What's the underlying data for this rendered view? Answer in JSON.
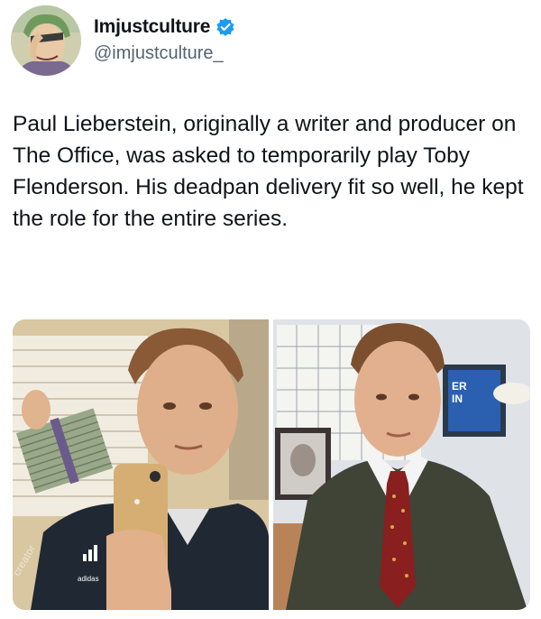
{
  "author": {
    "display_name": "Imjustculture",
    "handle": "@imjustculture_",
    "verified": true,
    "avatar_icon": "anime-avatar",
    "verified_icon": "verified-badge-icon",
    "verified_color": "#1d9bf0"
  },
  "tweet": {
    "text": "Paul Lieberstein, originally a writer and producer on The Office, was asked to temporarily play Toby Flenderson. His deadpan delivery fit so well, he kept the role for the entire series."
  },
  "media": {
    "left_photo": {
      "watermark": "creator"
    },
    "right_photo": {}
  }
}
